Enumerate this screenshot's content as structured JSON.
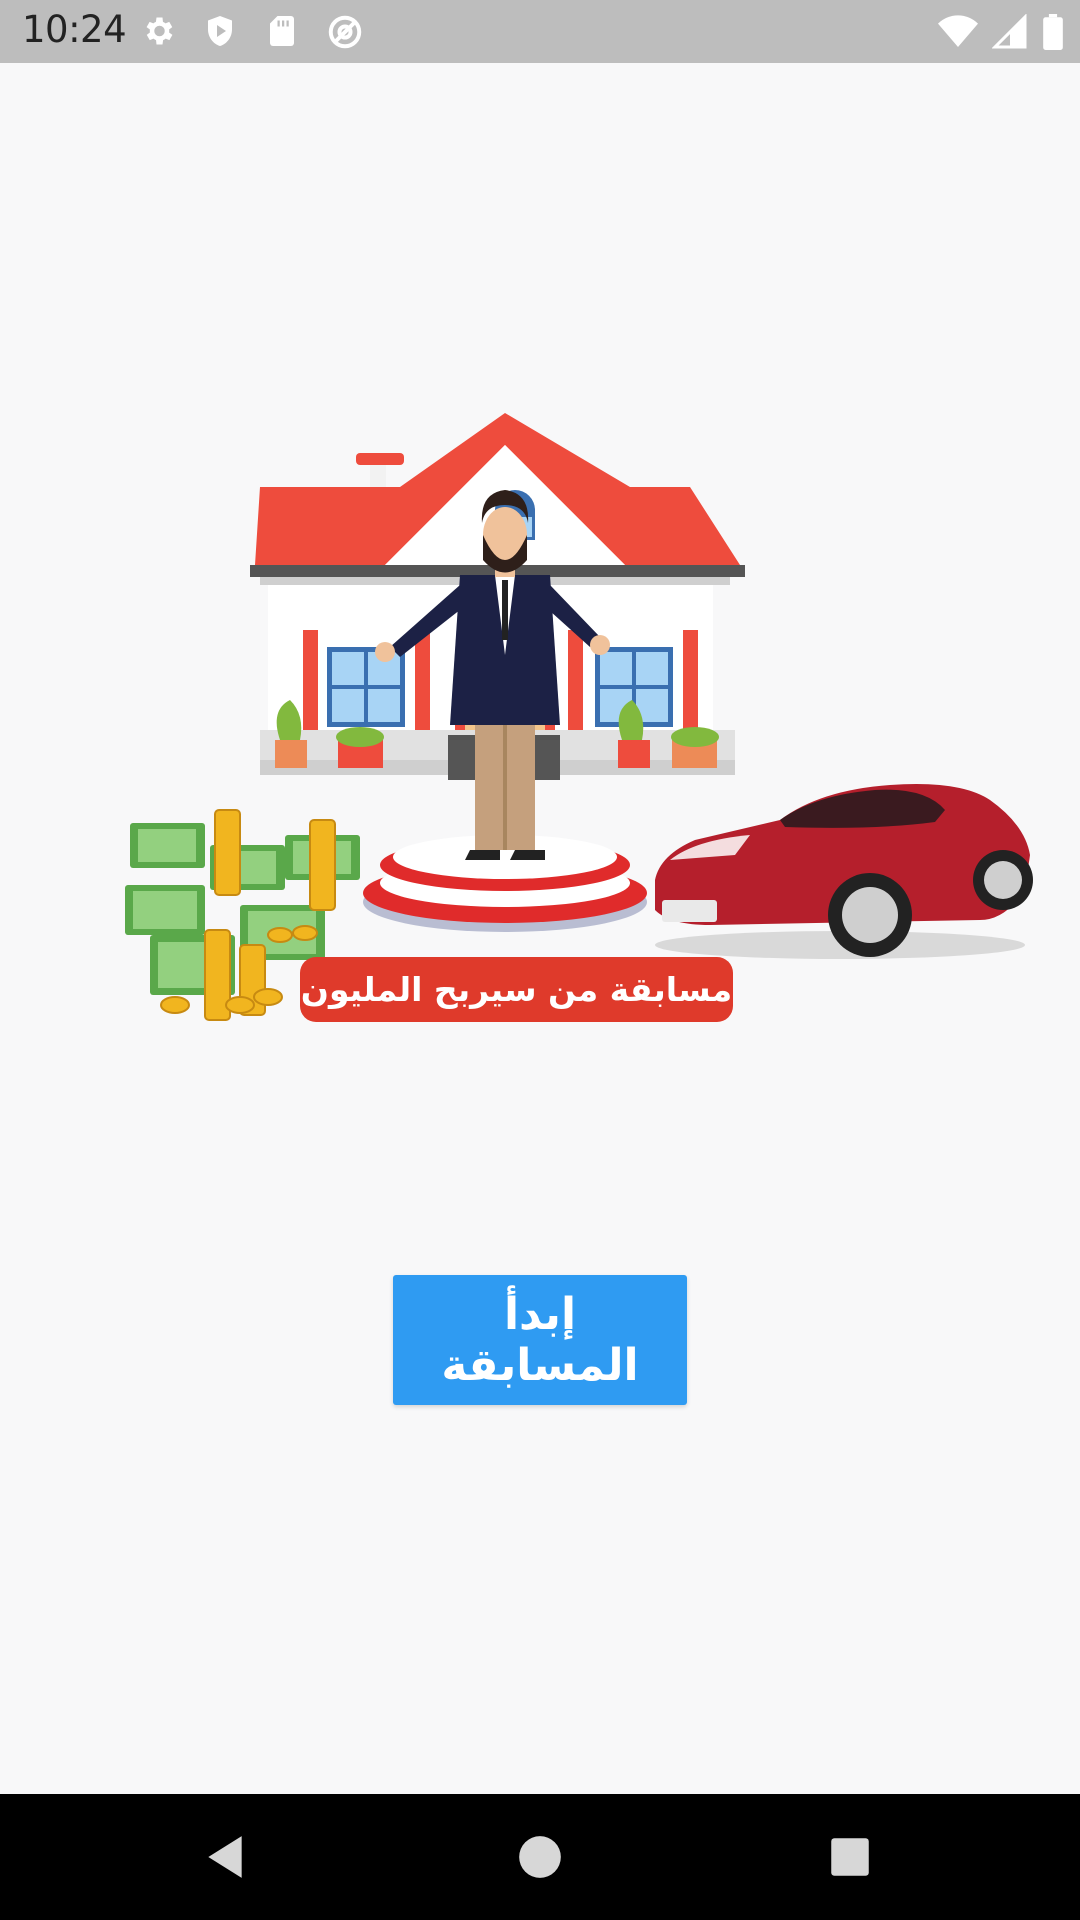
{
  "status_bar": {
    "time": "10:24",
    "left_icons": [
      "gear-icon",
      "play-protect-icon",
      "sd-card-icon",
      "at-sign-icon"
    ],
    "right_icons": [
      "wifi-icon",
      "signal-icon",
      "battery-icon"
    ]
  },
  "hero": {
    "banner_text": "مسابقة من سيربح المليون"
  },
  "main": {
    "start_button_label": "إبدأ المسابقة"
  },
  "nav_bar": {
    "buttons": [
      "back-icon",
      "home-icon",
      "recents-icon"
    ]
  },
  "colors": {
    "status_bar": "#bdbdbd",
    "background": "#f8f8f9",
    "button": "#2f9bf2",
    "banner": "#df3a2b",
    "nav_bar": "#000000"
  }
}
